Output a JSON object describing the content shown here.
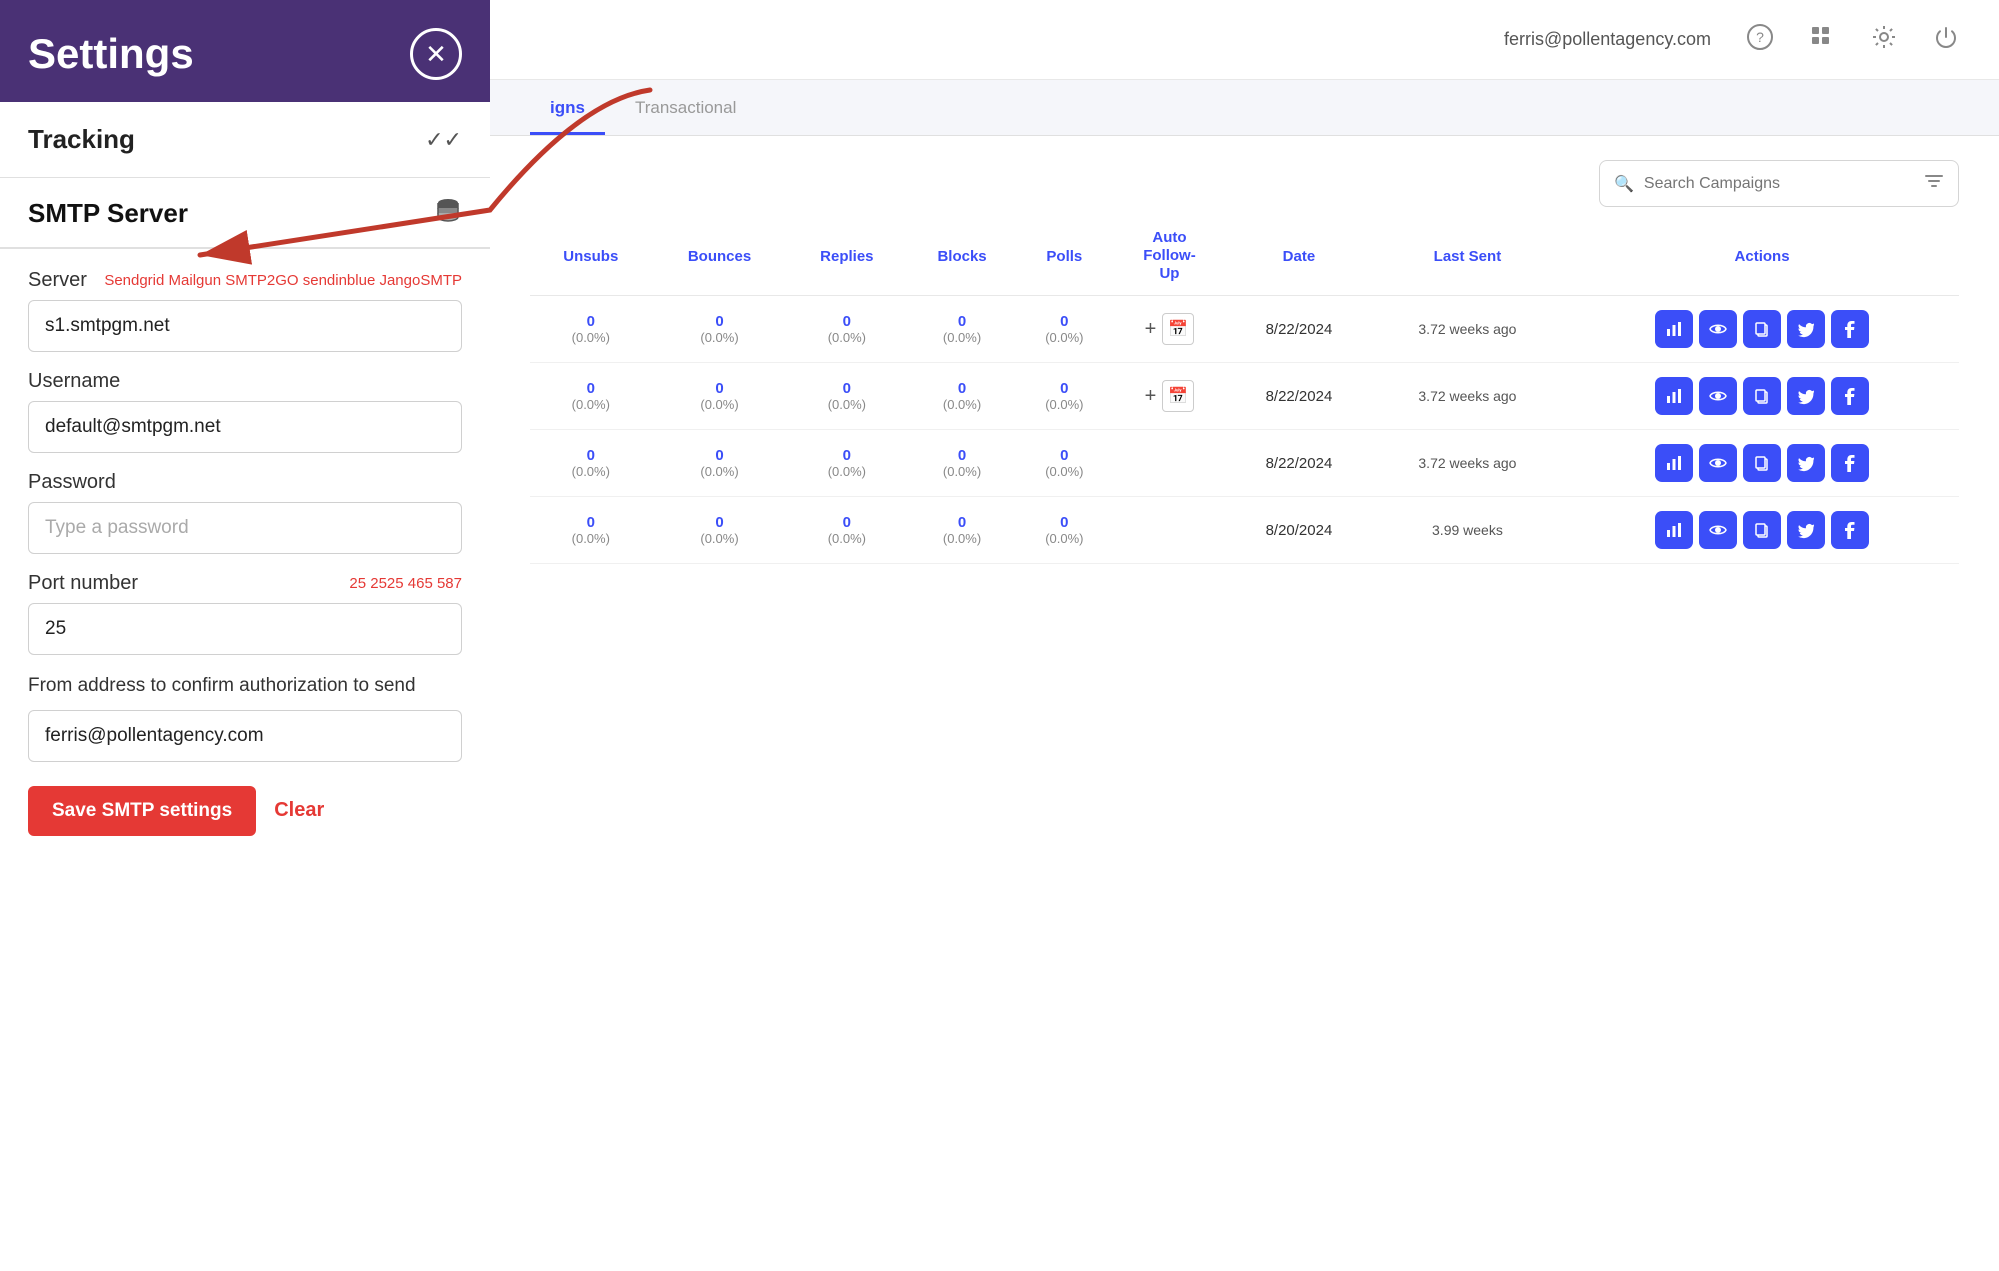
{
  "settings": {
    "title": "Settings",
    "close_label": "×",
    "tracking": {
      "label": "Tracking",
      "checkmark": "✓✓"
    },
    "smtp": {
      "title": "SMTP Server",
      "db_icon": "🗄",
      "server_label": "Server",
      "server_hint": "Sendgrid Mailgun SMTP2GO sendinblue JangoSMTP",
      "server_value": "s1.smtpgm.net",
      "username_label": "Username",
      "username_value": "default@smtpgm.net",
      "password_label": "Password",
      "password_placeholder": "Type a password",
      "port_label": "Port number",
      "port_hint": "25 2525 465 587",
      "port_value": "25",
      "from_address_label": "From address to confirm authorization to send",
      "from_address_value": "ferris@pollentagency.com",
      "save_label": "Save SMTP settings",
      "clear_label": "Clear"
    }
  },
  "header": {
    "user_email": "ferris@pollentagency.com"
  },
  "tabs": [
    {
      "label": "igns",
      "active": true
    },
    {
      "label": "Transactional",
      "active": false
    }
  ],
  "search": {
    "placeholder": "Search Campaigns"
  },
  "table": {
    "columns": [
      "Unsubs",
      "Bounces",
      "Replies",
      "Blocks",
      "Polls",
      "Auto Follow-Up",
      "Date",
      "Last Sent",
      "Actions"
    ],
    "rows": [
      {
        "unsubs": "0",
        "unsubs_pct": "(0.0%)",
        "bounces": "0",
        "bounces_pct": "(0.0%)",
        "replies": "0",
        "replies_pct": "(0.0%)",
        "blocks": "0",
        "blocks_pct": "(0.0%)",
        "polls": "0",
        "polls_pct": "(0.0%)",
        "date": "8/22/2024",
        "last_sent": "3.72 weeks ago"
      },
      {
        "unsubs": "0",
        "unsubs_pct": "(0.0%)",
        "bounces": "0",
        "bounces_pct": "(0.0%)",
        "replies": "0",
        "replies_pct": "(0.0%)",
        "blocks": "0",
        "blocks_pct": "(0.0%)",
        "polls": "0",
        "polls_pct": "(0.0%)",
        "date": "8/22/2024",
        "last_sent": "3.72 weeks ago"
      },
      {
        "unsubs": "0",
        "unsubs_pct": "(0.0%)",
        "bounces": "0",
        "bounces_pct": "(0.0%)",
        "replies": "0",
        "replies_pct": "(0.0%)",
        "blocks": "0",
        "blocks_pct": "(0.0%)",
        "polls": "0",
        "polls_pct": "(0.0%)",
        "date": "8/22/2024",
        "last_sent": "3.72 weeks ago"
      },
      {
        "unsubs": "0",
        "unsubs_pct": "(0.0%)",
        "bounces": "0",
        "bounces_pct": "(0.0%)",
        "replies": "0",
        "replies_pct": "(0.0%)",
        "blocks": "0",
        "blocks_pct": "(0.0%)",
        "polls": "0",
        "polls_pct": "(0.0%)",
        "date": "8/20/2024",
        "last_sent": "3.99 weeks"
      }
    ]
  }
}
